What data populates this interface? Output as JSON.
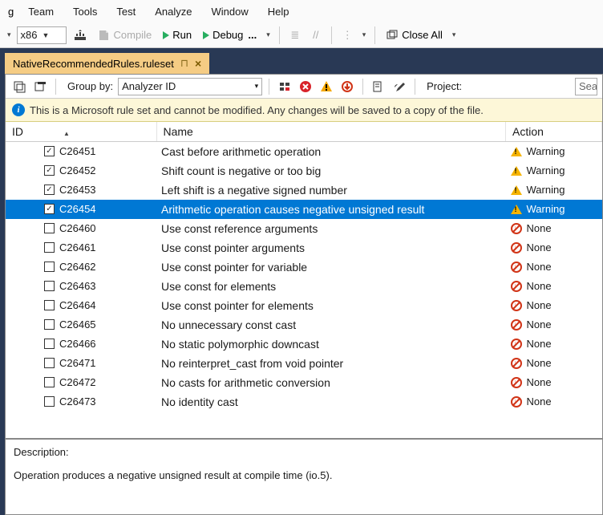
{
  "menu": {
    "frag": "g",
    "items": [
      "Team",
      "Tools",
      "Test",
      "Analyze",
      "Window",
      "Help"
    ]
  },
  "toolbar": {
    "platform": "x86",
    "compile": "Compile",
    "run": "Run",
    "debug": "Debug",
    "debug_ellipsis": "...",
    "close_all": "Close All"
  },
  "tab": {
    "title": "NativeRecommendedRules.ruleset"
  },
  "tb2": {
    "group_by_label": "Group by:",
    "group_by_value": "Analyzer ID",
    "project_label": "Project:",
    "search_placeholder": "Sea"
  },
  "infobar": {
    "text": "This is a Microsoft rule set and cannot be modified. Any changes will be saved to a copy of the file."
  },
  "columns": {
    "id": "ID",
    "name": "Name",
    "action": "Action"
  },
  "rows": [
    {
      "checked": true,
      "id": "C26451",
      "name": "Cast before arithmetic operation",
      "action": "Warning",
      "kind": "warn"
    },
    {
      "checked": true,
      "id": "C26452",
      "name": "Shift count is negative or too big",
      "action": "Warning",
      "kind": "warn"
    },
    {
      "checked": true,
      "id": "C26453",
      "name": "Left shift is a negative signed number",
      "action": "Warning",
      "kind": "warn"
    },
    {
      "checked": true,
      "id": "C26454",
      "name": "Arithmetic operation causes negative unsigned result",
      "action": "Warning",
      "kind": "warn",
      "selected": true
    },
    {
      "checked": false,
      "id": "C26460",
      "name": "Use const reference arguments",
      "action": "None",
      "kind": "none"
    },
    {
      "checked": false,
      "id": "C26461",
      "name": "Use const pointer arguments",
      "action": "None",
      "kind": "none"
    },
    {
      "checked": false,
      "id": "C26462",
      "name": "Use const pointer for variable",
      "action": "None",
      "kind": "none"
    },
    {
      "checked": false,
      "id": "C26463",
      "name": "Use const for elements",
      "action": "None",
      "kind": "none"
    },
    {
      "checked": false,
      "id": "C26464",
      "name": "Use const pointer for elements",
      "action": "None",
      "kind": "none"
    },
    {
      "checked": false,
      "id": "C26465",
      "name": "No unnecessary const cast",
      "action": "None",
      "kind": "none"
    },
    {
      "checked": false,
      "id": "C26466",
      "name": "No static polymorphic downcast",
      "action": "None",
      "kind": "none"
    },
    {
      "checked": false,
      "id": "C26471",
      "name": "No reinterpret_cast from void pointer",
      "action": "None",
      "kind": "none"
    },
    {
      "checked": false,
      "id": "C26472",
      "name": "No casts for arithmetic conversion",
      "action": "None",
      "kind": "none"
    },
    {
      "checked": false,
      "id": "C26473",
      "name": "No identity cast",
      "action": "None",
      "kind": "none"
    }
  ],
  "description": {
    "header": "Description:",
    "body": "Operation produces a negative unsigned result at compile time (io.5)."
  }
}
